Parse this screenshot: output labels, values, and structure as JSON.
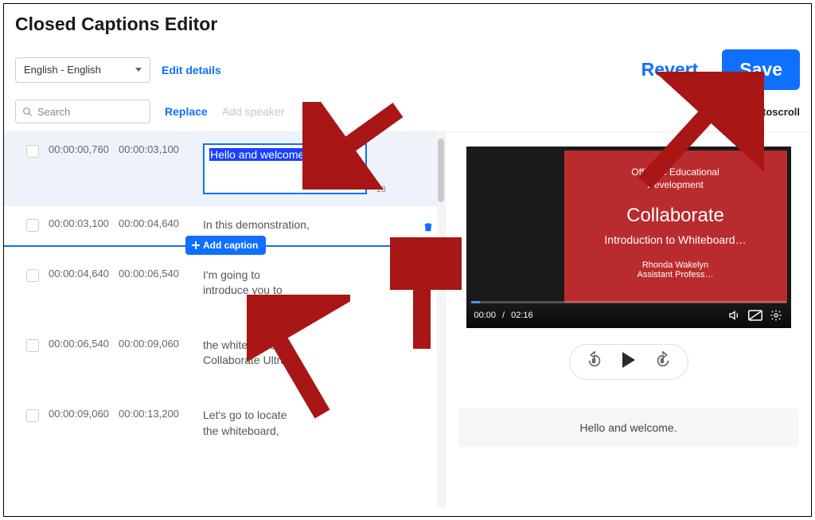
{
  "title": "Closed Captions Editor",
  "toolbar": {
    "language": "English - English",
    "edit_details": "Edit details",
    "revert": "Revert",
    "save": "Save",
    "search_placeholder": "Search",
    "replace": "Replace",
    "add_speaker": "Add speaker",
    "autoscroll": "Autoscroll"
  },
  "captions": [
    {
      "start": "00:00:00,760",
      "end": "00:00:03,100",
      "text": "Hello and welcome.",
      "char_count": "18",
      "selected": true
    },
    {
      "start": "00:00:03,100",
      "end": "00:00:04,640",
      "text": "In this demonstration,"
    },
    {
      "start": "00:00:04,640",
      "end": "00:00:06,540",
      "text": "I'm going to introduce you to"
    },
    {
      "start": "00:00:06,540",
      "end": "00:00:09,060",
      "text": "the whiteboard in Collaborate Ultra."
    },
    {
      "start": "00:00:09,060",
      "end": "00:00:13,200",
      "text": "Let's go to locate the whiteboard,"
    }
  ],
  "add_caption_label": "Add caption",
  "video": {
    "cur_time": "00:00",
    "duration": "02:16",
    "office_line1": "Office of Educational",
    "office_line2": "Development",
    "title": "Collaborate",
    "subtitle": "Introduction to Whiteboard…",
    "presenter_name": "Rhonda Wakelyn",
    "presenter_title": "Assistant Profess…",
    "skip_back": "5",
    "skip_fwd": "5"
  },
  "preview_caption": "Hello and welcome.",
  "colors": {
    "accent": "#0f6fff",
    "arrow": "#a81616"
  }
}
